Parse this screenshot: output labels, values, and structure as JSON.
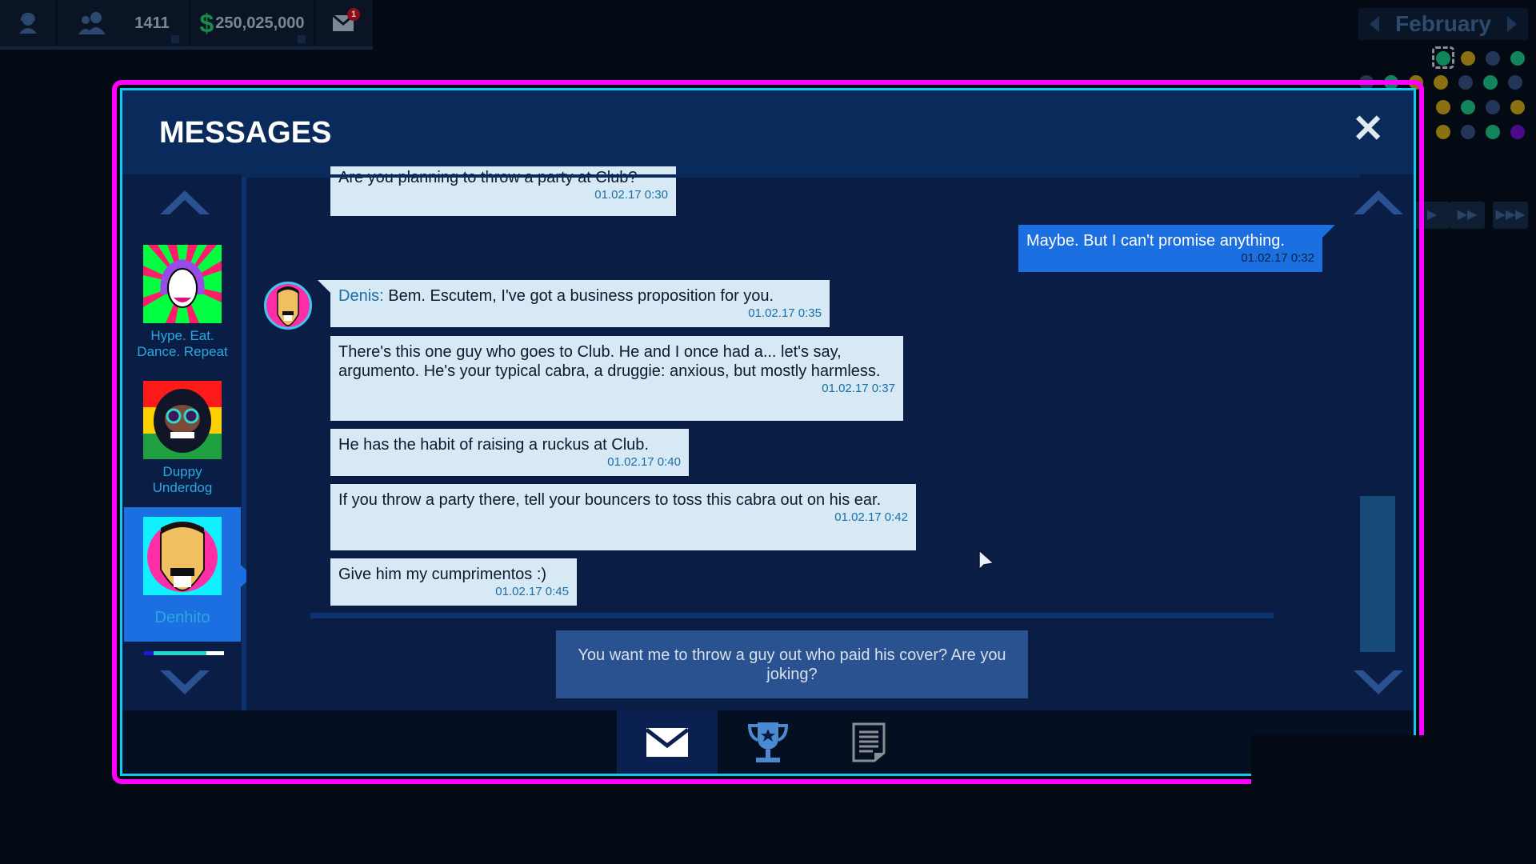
{
  "hud": {
    "staff_icon": "headset-person-icon",
    "guests_icon": "people-icon",
    "guests_count": "1411",
    "money_icon": "dollar-icon",
    "money": "250,025,000",
    "mail_icon": "envelope-icon",
    "mail_badge": "1"
  },
  "calendar": {
    "month": "February",
    "prev_icon": "triangle-left-icon",
    "next_icon": "triangle-right-icon",
    "day_dots": [
      [
        "green",
        "gold",
        "slate",
        "green"
      ],
      [
        "slate",
        "green",
        "gold",
        "gold",
        "slate",
        "green",
        "slate"
      ],
      [
        "gold",
        "green",
        "slate",
        "gold"
      ],
      [
        "gold",
        "slate",
        "green",
        "purple"
      ]
    ]
  },
  "speed_controls": [
    {
      "label": "▶",
      "icon": "play-icon"
    },
    {
      "label": "▶▶",
      "icon": "fast-forward-icon"
    },
    {
      "label": "▶▶▶",
      "icon": "fastest-forward-icon"
    }
  ],
  "modal": {
    "title": "MESSAGES",
    "close_icon": "close-x-icon",
    "close_glyph": "✕"
  },
  "contacts": [
    {
      "name": "Hype. Eat. Dance. Repeat",
      "line1": "Hype. Eat.",
      "line2": "Dance. Repeat",
      "selected": false
    },
    {
      "name": "Duppy Underdog",
      "line1": "Duppy",
      "line2": "Underdog",
      "selected": false
    },
    {
      "name": "Denhito",
      "line1": "Denhito",
      "line2": "",
      "selected": true
    }
  ],
  "contacts_progress": 0.78,
  "messages": [
    {
      "from": "them",
      "sender": "",
      "text": "Are you planning to throw a party at Club?",
      "time": "01.02.17 0:30"
    },
    {
      "from": "me",
      "sender": "",
      "text": "Maybe. But I can't promise anything.",
      "time": "01.02.17 0:32"
    },
    {
      "from": "them",
      "sender": "Denis:",
      "text": " Bem. Escutem, I've got a business proposition for you.",
      "time": "01.02.17 0:35"
    },
    {
      "from": "them",
      "sender": "",
      "text": "There's this one guy who goes to Club. He and I once had a... let's say, argumento. He's your typical cabra, a druggie: anxious, but mostly harmless.",
      "time": "01.02.17 0:37"
    },
    {
      "from": "them",
      "sender": "",
      "text": "He has the habit of raising a ruckus at Club.",
      "time": "01.02.17 0:40"
    },
    {
      "from": "them",
      "sender": "",
      "text": "If you throw a party there, tell your bouncers to toss this cabra out on his ear.",
      "time": "01.02.17 0:42"
    },
    {
      "from": "them",
      "sender": "",
      "text": "Give him my cumprimentos :)",
      "time": "01.02.17 0:45"
    }
  ],
  "reply_option": "You want me to throw a guy out who paid his cover? Are you joking?",
  "tabs": [
    {
      "name": "messages",
      "icon": "envelope-icon",
      "active": true
    },
    {
      "name": "achievements",
      "icon": "trophy-icon",
      "active": false
    },
    {
      "name": "notes",
      "icon": "document-icon",
      "active": false
    }
  ],
  "colors": {
    "frame_outer": "#ff00ff",
    "frame_inner": "#14c8f0",
    "accent": "#1b6fe0",
    "bubble_incoming": "#d6e9f4",
    "timestamp": "#1a6ea8",
    "money_green": "#1a8a4a"
  }
}
